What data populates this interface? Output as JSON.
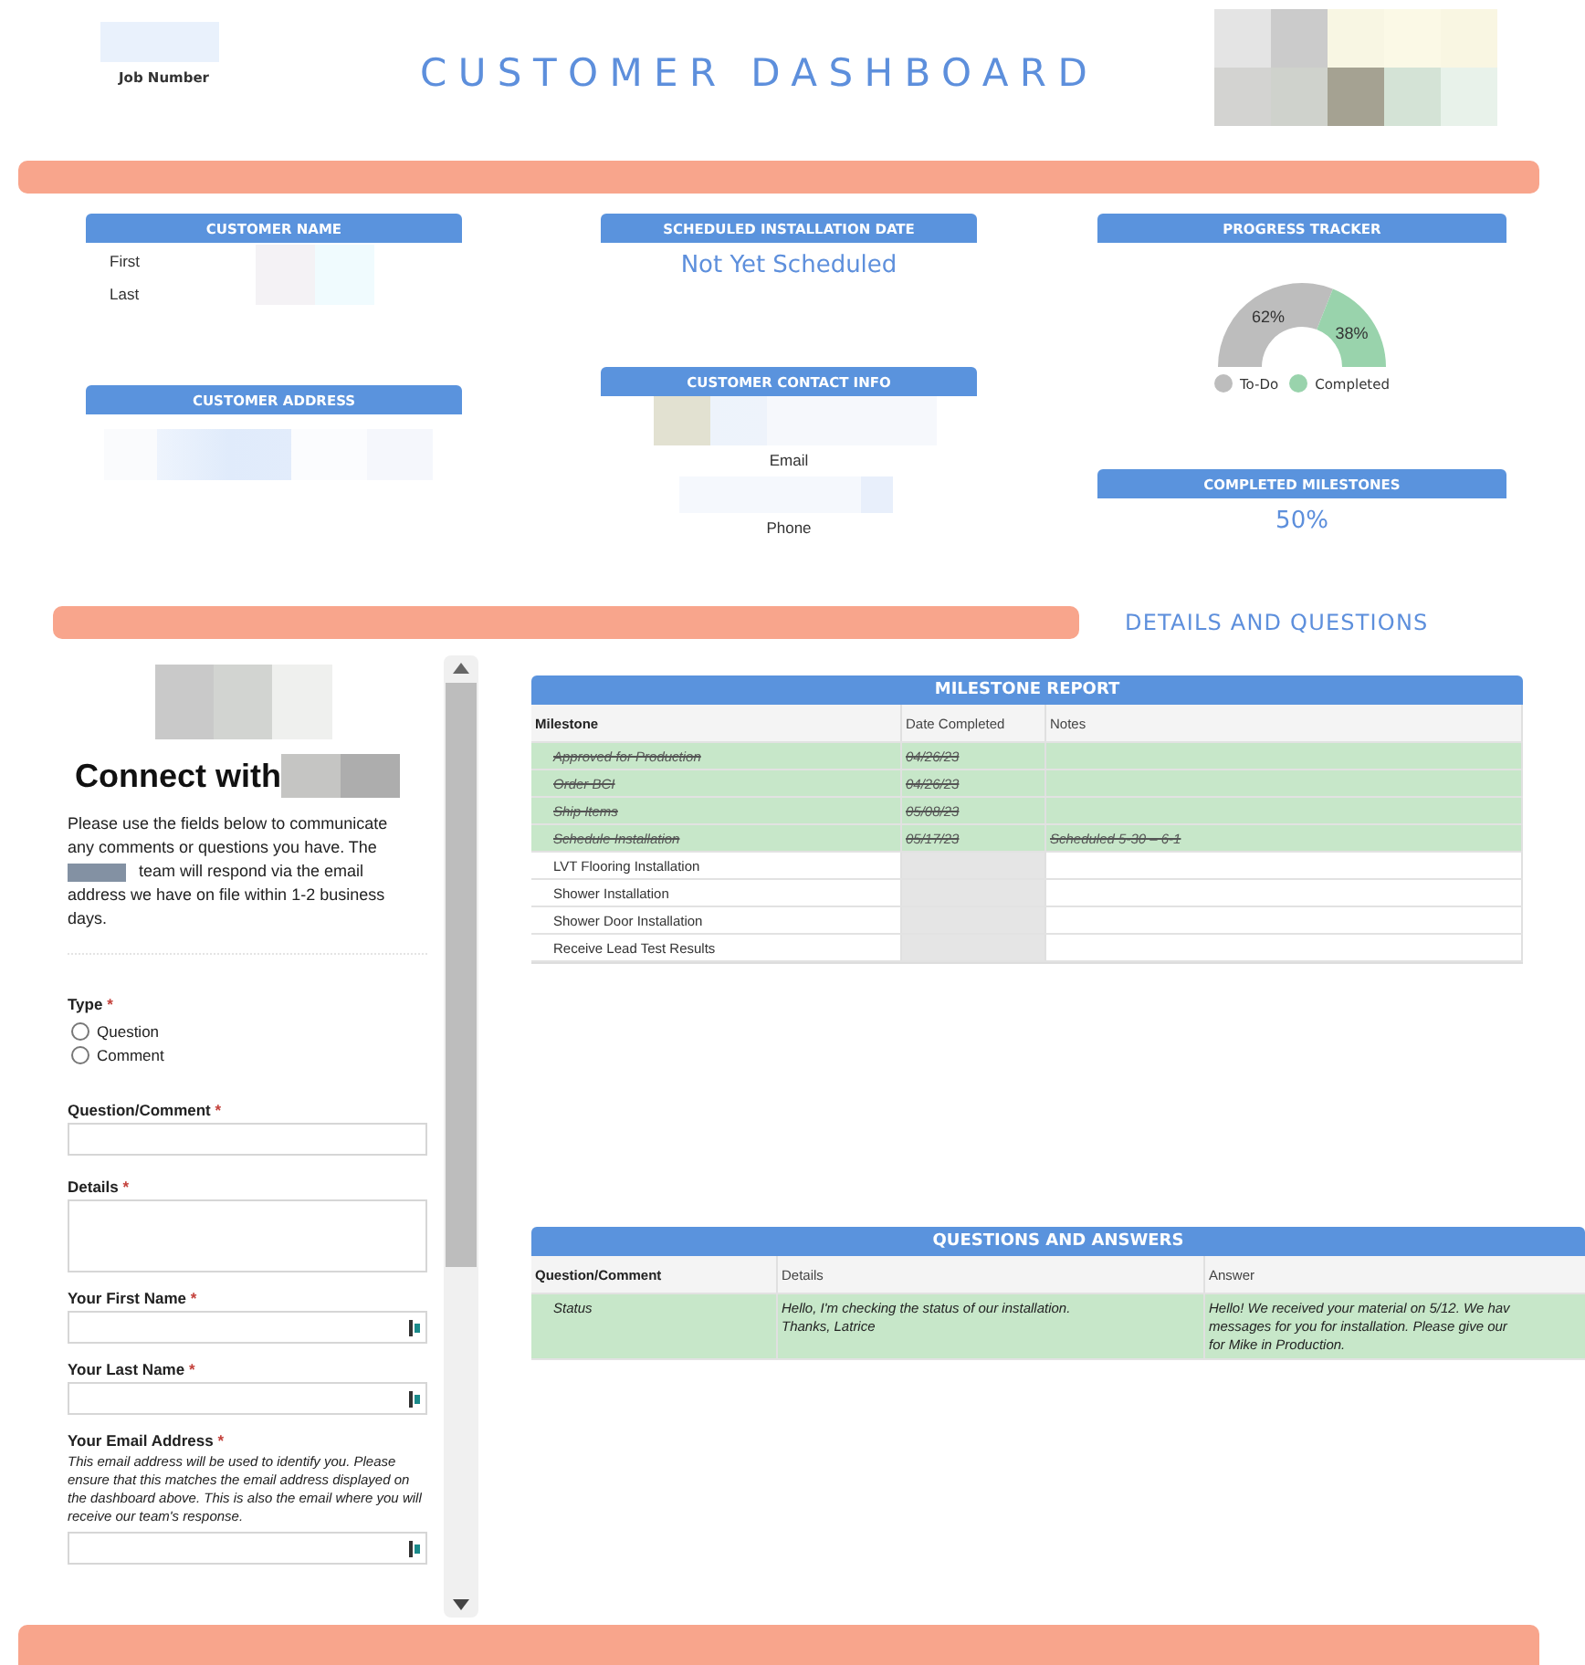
{
  "header": {
    "job_label": "Job Number",
    "title": "CUSTOMER DASHBOARD"
  },
  "customer_name": {
    "heading": "CUSTOMER NAME",
    "fields": [
      "First",
      "Last"
    ]
  },
  "installation": {
    "heading": "SCHEDULED INSTALLATION DATE",
    "value": "Not Yet Scheduled"
  },
  "progress": {
    "heading": "PROGRESS TRACKER",
    "chart_data": {
      "type": "donut",
      "categories": [
        "To-Do",
        "Completed"
      ],
      "values": [
        62,
        38
      ],
      "data_labels": true,
      "value_labels": [
        "62%",
        "38%"
      ],
      "legend": "bottom"
    },
    "colors": [
      {
        "color": "#bdbdbd"
      },
      {
        "color": "#99d3ac"
      }
    ]
  },
  "customer_address": {
    "heading": "CUSTOMER ADDRESS"
  },
  "contact": {
    "heading": "CUSTOMER CONTACT INFO",
    "fields": [
      "Email",
      "Phone"
    ]
  },
  "milestones_summary": {
    "heading": "COMPLETED MILESTONES",
    "value": "50%"
  },
  "section_title": "DETAILS AND QUESTIONS",
  "form": {
    "heading": "Connect with",
    "intro_start": "Please use the fields below to communicate any comments or questions you have. The",
    "intro_middle": "team will respond via the email",
    "intro_end": "address we have on file within 1-2 business days.",
    "fields": [
      {
        "kind": "radio",
        "label": "Type",
        "mark": "*",
        "options": [
          {
            "label": "Question",
            "checked": false
          },
          {
            "label": "Comment",
            "checked": false
          }
        ]
      },
      {
        "kind": "text",
        "label": "Question/Comment",
        "mark": "*"
      },
      {
        "kind": "textarea",
        "label": "Details",
        "mark": "*"
      },
      {
        "kind": "autofill",
        "label": "Your First Name",
        "mark": "*"
      },
      {
        "kind": "autofill",
        "label": "Your Last Name",
        "mark": "*"
      },
      {
        "kind": "autofill",
        "label": "Your Email Address",
        "mark": "*",
        "help": "This email address will be used to identify you. Please ensure that this matches the email address displayed on the dashboard above. This is also the email where you will receive our team's response."
      }
    ]
  },
  "milestone_report": {
    "title": "MILESTONE REPORT",
    "columns": [
      "Milestone",
      "Date Completed",
      "Notes"
    ],
    "rows": [
      {
        "milestone": "Approved for Production",
        "date": "04/26/23",
        "notes": "",
        "completed": true
      },
      {
        "milestone": "Order BCI",
        "date": "04/26/23",
        "notes": "",
        "completed": true
      },
      {
        "milestone": "Ship Items",
        "date": "05/08/23",
        "notes": "",
        "completed": true
      },
      {
        "milestone": "Schedule Installation",
        "date": "05/17/23",
        "notes": "Scheduled 5-30 – 6-1",
        "completed": true
      },
      {
        "milestone": "LVT Flooring Installation",
        "date": "",
        "notes": "",
        "completed": false
      },
      {
        "milestone": "Shower Installation",
        "date": "",
        "notes": "",
        "completed": false
      },
      {
        "milestone": "Shower Door Installation",
        "date": "",
        "notes": "",
        "completed": false
      },
      {
        "milestone": "Receive Lead Test Results",
        "date": "",
        "notes": "",
        "completed": false
      }
    ]
  },
  "questions": {
    "title": "QUESTIONS AND ANSWERS",
    "columns": [
      "Question/Comment",
      "Details",
      "Answer"
    ],
    "rows": [
      {
        "question": "Status",
        "details": [
          "Hello, I'm checking the status of our installation.",
          "Thanks, Latrice"
        ],
        "answer": [
          "Hello! We received your material on 5/12. We hav",
          "messages for you for installation. Please give our",
          "for Mike in Production."
        ]
      }
    ]
  }
}
